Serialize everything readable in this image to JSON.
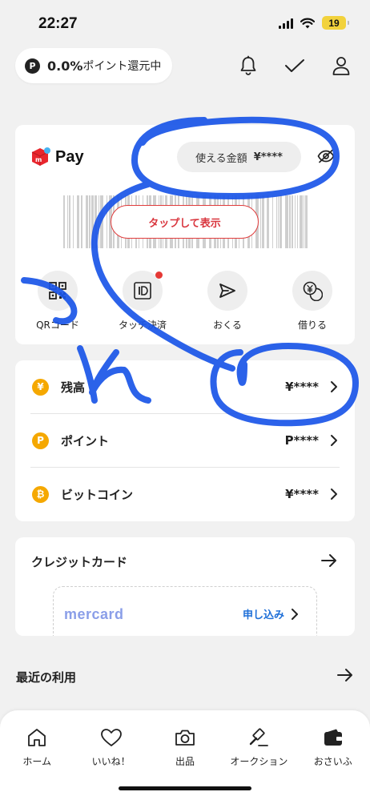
{
  "status_bar": {
    "time": "22:27",
    "battery": "19"
  },
  "header": {
    "points_badge": "P",
    "points_rate": "0.0%",
    "points_text": "ポイント還元中"
  },
  "pay_card": {
    "logo_text": "Pay",
    "logo_badge": "m",
    "balance_label": "使える金額",
    "balance_value": "¥****",
    "tap_button": "タップして表示",
    "actions": [
      {
        "label": "QRコード",
        "icon": "qr-code-icon"
      },
      {
        "label": "タッチ決済",
        "icon": "id-touch-icon"
      },
      {
        "label": "おくる",
        "icon": "send-icon"
      },
      {
        "label": "借りる",
        "icon": "borrow-coins-icon"
      }
    ]
  },
  "balances": [
    {
      "label": "残高",
      "value": "¥****",
      "coin": "¥"
    },
    {
      "label": "ポイント",
      "value": "P****",
      "coin": "P"
    },
    {
      "label": "ビットコイン",
      "value": "¥****",
      "coin": "₿"
    }
  ],
  "credit": {
    "title": "クレジットカード",
    "card_logo": "mercard",
    "apply": "申し込み"
  },
  "recent": {
    "title": "最近の利用"
  },
  "bottom_nav": [
    {
      "label": "ホーム",
      "icon": "home-icon"
    },
    {
      "label": "いいね！",
      "icon": "heart-icon"
    },
    {
      "label": "出品",
      "icon": "camera-icon"
    },
    {
      "label": "オークション",
      "icon": "gavel-icon"
    },
    {
      "label": "おさいふ",
      "icon": "wallet-icon"
    }
  ],
  "colors": {
    "accent_red": "#d9363e",
    "coin_orange": "#f5a800",
    "link_blue": "#1e6fd8",
    "scribble_blue": "#1a55e8"
  }
}
